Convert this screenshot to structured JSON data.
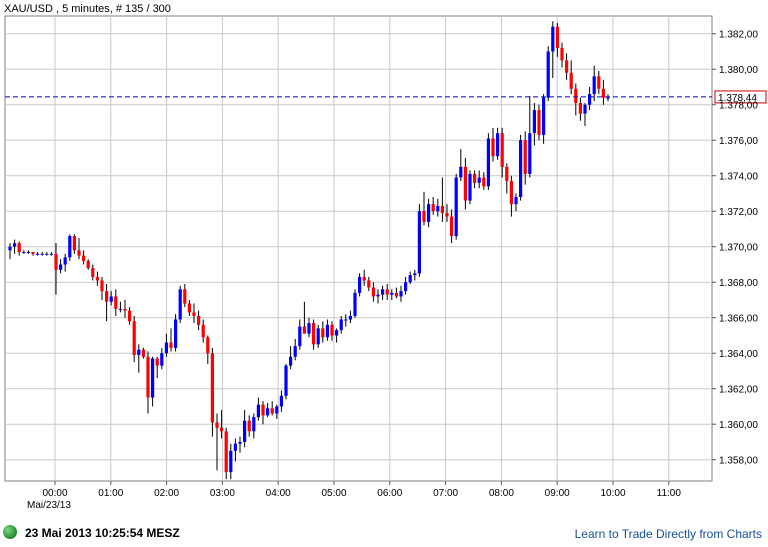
{
  "chart_data": {
    "type": "candlestick",
    "title": "XAU/USD , 5 minutes, # 135 / 300",
    "date_label": "Mai/23/13",
    "x_ticks": [
      "00:00",
      "01:00",
      "02:00",
      "03:00",
      "04:00",
      "05:00",
      "06:00",
      "07:00",
      "08:00",
      "09:00",
      "10:00",
      "11:00"
    ],
    "y_ticks": [
      "1.358,00",
      "1.360,00",
      "1.362,00",
      "1.364,00",
      "1.366,00",
      "1.368,00",
      "1.370,00",
      "1.372,00",
      "1.374,00",
      "1.376,00",
      "1.378,00",
      "1.380,00",
      "1.382,00"
    ],
    "ylim": [
      1356.8,
      1383.0
    ],
    "current_price": 1378.44,
    "current_price_label": "1.378,44",
    "grid": true,
    "colors": {
      "up": "#0000ff",
      "down": "#ff0000",
      "grid": "#c8c8c8",
      "current_line": "#0000cc"
    },
    "candles": [
      {
        "o": 1369.8,
        "h": 1370.2,
        "l": 1369.3,
        "c": 1370.0
      },
      {
        "o": 1370.0,
        "h": 1370.4,
        "l": 1369.6,
        "c": 1370.2
      },
      {
        "o": 1370.2,
        "h": 1370.3,
        "l": 1369.5,
        "c": 1369.7
      },
      {
        "o": 1369.7,
        "h": 1369.8,
        "l": 1369.6,
        "c": 1369.7
      },
      {
        "o": 1369.7,
        "h": 1369.8,
        "l": 1369.6,
        "c": 1369.7
      },
      {
        "o": 1369.7,
        "h": 1369.7,
        "l": 1369.5,
        "c": 1369.6
      },
      {
        "o": 1369.6,
        "h": 1369.7,
        "l": 1369.5,
        "c": 1369.6
      },
      {
        "o": 1369.6,
        "h": 1369.7,
        "l": 1369.5,
        "c": 1369.6
      },
      {
        "o": 1369.6,
        "h": 1369.7,
        "l": 1369.5,
        "c": 1369.6
      },
      {
        "o": 1369.6,
        "h": 1369.7,
        "l": 1369.5,
        "c": 1369.6
      },
      {
        "o": 1369.6,
        "h": 1370.2,
        "l": 1367.3,
        "c": 1368.7
      },
      {
        "o": 1368.7,
        "h": 1369.3,
        "l": 1368.5,
        "c": 1369.0
      },
      {
        "o": 1369.0,
        "h": 1369.6,
        "l": 1368.6,
        "c": 1369.4
      },
      {
        "o": 1369.4,
        "h": 1370.7,
        "l": 1369.2,
        "c": 1370.6
      },
      {
        "o": 1370.6,
        "h": 1370.7,
        "l": 1369.6,
        "c": 1369.8
      },
      {
        "o": 1369.8,
        "h": 1370.5,
        "l": 1369.3,
        "c": 1369.5
      },
      {
        "o": 1369.5,
        "h": 1369.8,
        "l": 1369.0,
        "c": 1369.2
      },
      {
        "o": 1369.2,
        "h": 1369.3,
        "l": 1368.7,
        "c": 1368.8
      },
      {
        "o": 1368.8,
        "h": 1369.0,
        "l": 1368.1,
        "c": 1368.3
      },
      {
        "o": 1368.3,
        "h": 1368.6,
        "l": 1367.8,
        "c": 1368.1
      },
      {
        "o": 1368.1,
        "h": 1368.3,
        "l": 1367.0,
        "c": 1367.5
      },
      {
        "o": 1367.5,
        "h": 1367.9,
        "l": 1365.8,
        "c": 1366.9
      },
      {
        "o": 1366.9,
        "h": 1367.5,
        "l": 1366.7,
        "c": 1367.2
      },
      {
        "o": 1367.2,
        "h": 1367.6,
        "l": 1366.1,
        "c": 1366.5
      },
      {
        "o": 1366.5,
        "h": 1366.9,
        "l": 1366.3,
        "c": 1366.5
      },
      {
        "o": 1366.5,
        "h": 1367.0,
        "l": 1366.0,
        "c": 1366.4
      },
      {
        "o": 1366.4,
        "h": 1366.6,
        "l": 1365.6,
        "c": 1365.8
      },
      {
        "o": 1365.8,
        "h": 1366.1,
        "l": 1363.5,
        "c": 1363.9
      },
      {
        "o": 1363.9,
        "h": 1364.5,
        "l": 1362.9,
        "c": 1364.2
      },
      {
        "o": 1364.2,
        "h": 1364.3,
        "l": 1363.7,
        "c": 1363.8
      },
      {
        "o": 1363.8,
        "h": 1364.1,
        "l": 1360.6,
        "c": 1361.5
      },
      {
        "o": 1361.5,
        "h": 1363.8,
        "l": 1361.0,
        "c": 1363.7
      },
      {
        "o": 1363.7,
        "h": 1363.8,
        "l": 1362.6,
        "c": 1363.3
      },
      {
        "o": 1363.3,
        "h": 1364.3,
        "l": 1363.1,
        "c": 1364.0
      },
      {
        "o": 1364.0,
        "h": 1365.1,
        "l": 1363.8,
        "c": 1364.6
      },
      {
        "o": 1364.6,
        "h": 1365.4,
        "l": 1364.1,
        "c": 1364.3
      },
      {
        "o": 1364.3,
        "h": 1366.2,
        "l": 1364.1,
        "c": 1365.9
      },
      {
        "o": 1365.9,
        "h": 1367.8,
        "l": 1365.7,
        "c": 1367.6
      },
      {
        "o": 1367.6,
        "h": 1367.9,
        "l": 1366.6,
        "c": 1366.8
      },
      {
        "o": 1366.8,
        "h": 1367.0,
        "l": 1366.1,
        "c": 1366.3
      },
      {
        "o": 1366.3,
        "h": 1366.8,
        "l": 1365.7,
        "c": 1366.1
      },
      {
        "o": 1366.1,
        "h": 1366.4,
        "l": 1365.3,
        "c": 1365.6
      },
      {
        "o": 1365.6,
        "h": 1365.9,
        "l": 1364.6,
        "c": 1364.9
      },
      {
        "o": 1364.9,
        "h": 1365.0,
        "l": 1363.4,
        "c": 1364.0
      },
      {
        "o": 1364.0,
        "h": 1364.3,
        "l": 1359.3,
        "c": 1360.1
      },
      {
        "o": 1360.1,
        "h": 1360.6,
        "l": 1357.4,
        "c": 1359.8
      },
      {
        "o": 1359.8,
        "h": 1360.8,
        "l": 1359.2,
        "c": 1359.6
      },
      {
        "o": 1359.6,
        "h": 1359.8,
        "l": 1356.9,
        "c": 1357.3
      },
      {
        "o": 1357.3,
        "h": 1358.9,
        "l": 1356.9,
        "c": 1358.5
      },
      {
        "o": 1358.5,
        "h": 1359.2,
        "l": 1357.9,
        "c": 1358.9
      },
      {
        "o": 1358.9,
        "h": 1359.3,
        "l": 1358.4,
        "c": 1359.0
      },
      {
        "o": 1359.0,
        "h": 1360.8,
        "l": 1358.7,
        "c": 1360.2
      },
      {
        "o": 1360.2,
        "h": 1360.5,
        "l": 1359.3,
        "c": 1359.6
      },
      {
        "o": 1359.6,
        "h": 1360.6,
        "l": 1359.2,
        "c": 1360.4
      },
      {
        "o": 1360.4,
        "h": 1361.5,
        "l": 1360.2,
        "c": 1361.1
      },
      {
        "o": 1361.1,
        "h": 1361.3,
        "l": 1360.0,
        "c": 1360.5
      },
      {
        "o": 1360.5,
        "h": 1361.2,
        "l": 1360.4,
        "c": 1360.9
      },
      {
        "o": 1360.9,
        "h": 1361.3,
        "l": 1360.5,
        "c": 1360.6
      },
      {
        "o": 1360.6,
        "h": 1361.1,
        "l": 1360.3,
        "c": 1361.0
      },
      {
        "o": 1361.0,
        "h": 1361.9,
        "l": 1360.7,
        "c": 1361.6
      },
      {
        "o": 1361.6,
        "h": 1363.4,
        "l": 1361.4,
        "c": 1363.3
      },
      {
        "o": 1363.3,
        "h": 1364.4,
        "l": 1363.1,
        "c": 1363.8
      },
      {
        "o": 1363.8,
        "h": 1364.8,
        "l": 1363.6,
        "c": 1364.4
      },
      {
        "o": 1364.4,
        "h": 1365.9,
        "l": 1364.2,
        "c": 1365.5
      },
      {
        "o": 1365.5,
        "h": 1366.9,
        "l": 1365.3,
        "c": 1365.1
      },
      {
        "o": 1365.1,
        "h": 1366.0,
        "l": 1364.9,
        "c": 1365.7
      },
      {
        "o": 1365.7,
        "h": 1365.9,
        "l": 1364.2,
        "c": 1364.5
      },
      {
        "o": 1364.5,
        "h": 1365.6,
        "l": 1364.3,
        "c": 1365.4
      },
      {
        "o": 1365.4,
        "h": 1365.8,
        "l": 1364.6,
        "c": 1364.9
      },
      {
        "o": 1364.9,
        "h": 1365.9,
        "l": 1364.7,
        "c": 1365.6
      },
      {
        "o": 1365.6,
        "h": 1365.8,
        "l": 1364.7,
        "c": 1365.0
      },
      {
        "o": 1365.0,
        "h": 1365.4,
        "l": 1364.6,
        "c": 1365.3
      },
      {
        "o": 1365.3,
        "h": 1366.1,
        "l": 1365.1,
        "c": 1365.9
      },
      {
        "o": 1365.9,
        "h": 1366.2,
        "l": 1365.5,
        "c": 1365.9
      },
      {
        "o": 1365.9,
        "h": 1366.4,
        "l": 1365.7,
        "c": 1366.1
      },
      {
        "o": 1366.1,
        "h": 1367.6,
        "l": 1366.0,
        "c": 1367.4
      },
      {
        "o": 1367.4,
        "h": 1368.5,
        "l": 1367.2,
        "c": 1368.3
      },
      {
        "o": 1368.3,
        "h": 1368.7,
        "l": 1367.8,
        "c": 1368.1
      },
      {
        "o": 1368.1,
        "h": 1368.3,
        "l": 1367.5,
        "c": 1367.7
      },
      {
        "o": 1367.7,
        "h": 1368.0,
        "l": 1366.9,
        "c": 1367.2
      },
      {
        "o": 1367.2,
        "h": 1367.6,
        "l": 1366.8,
        "c": 1367.3
      },
      {
        "o": 1367.3,
        "h": 1367.8,
        "l": 1367.0,
        "c": 1367.6
      },
      {
        "o": 1367.6,
        "h": 1367.9,
        "l": 1367.0,
        "c": 1367.3
      },
      {
        "o": 1367.3,
        "h": 1367.6,
        "l": 1367.0,
        "c": 1367.4
      },
      {
        "o": 1367.4,
        "h": 1367.7,
        "l": 1367.1,
        "c": 1367.2
      },
      {
        "o": 1367.2,
        "h": 1367.8,
        "l": 1366.9,
        "c": 1367.5
      },
      {
        "o": 1367.5,
        "h": 1368.3,
        "l": 1367.3,
        "c": 1368.0
      },
      {
        "o": 1368.0,
        "h": 1368.6,
        "l": 1367.9,
        "c": 1368.4
      },
      {
        "o": 1368.4,
        "h": 1368.7,
        "l": 1368.1,
        "c": 1368.5
      },
      {
        "o": 1368.5,
        "h": 1372.4,
        "l": 1368.3,
        "c": 1372.0
      },
      {
        "o": 1372.0,
        "h": 1373.1,
        "l": 1371.2,
        "c": 1371.4
      },
      {
        "o": 1371.4,
        "h": 1372.7,
        "l": 1371.1,
        "c": 1372.4
      },
      {
        "o": 1372.4,
        "h": 1372.8,
        "l": 1371.8,
        "c": 1372.0
      },
      {
        "o": 1372.0,
        "h": 1372.7,
        "l": 1371.7,
        "c": 1372.3
      },
      {
        "o": 1372.3,
        "h": 1373.9,
        "l": 1371.4,
        "c": 1371.9
      },
      {
        "o": 1371.9,
        "h": 1372.4,
        "l": 1371.4,
        "c": 1371.7
      },
      {
        "o": 1371.7,
        "h": 1372.1,
        "l": 1370.2,
        "c": 1370.6
      },
      {
        "o": 1370.6,
        "h": 1374.1,
        "l": 1370.4,
        "c": 1373.9
      },
      {
        "o": 1373.9,
        "h": 1375.5,
        "l": 1373.7,
        "c": 1374.5
      },
      {
        "o": 1374.5,
        "h": 1375.0,
        "l": 1372.1,
        "c": 1372.6
      },
      {
        "o": 1372.6,
        "h": 1374.3,
        "l": 1372.4,
        "c": 1374.1
      },
      {
        "o": 1374.1,
        "h": 1374.3,
        "l": 1373.3,
        "c": 1373.6
      },
      {
        "o": 1373.6,
        "h": 1374.3,
        "l": 1373.3,
        "c": 1373.9
      },
      {
        "o": 1373.9,
        "h": 1374.2,
        "l": 1373.2,
        "c": 1373.4
      },
      {
        "o": 1373.4,
        "h": 1376.4,
        "l": 1373.2,
        "c": 1376.1
      },
      {
        "o": 1376.1,
        "h": 1376.7,
        "l": 1374.8,
        "c": 1375.1
      },
      {
        "o": 1375.1,
        "h": 1376.7,
        "l": 1374.9,
        "c": 1376.4
      },
      {
        "o": 1376.4,
        "h": 1376.7,
        "l": 1373.9,
        "c": 1374.5
      },
      {
        "o": 1374.5,
        "h": 1374.7,
        "l": 1373.0,
        "c": 1373.7
      },
      {
        "o": 1373.7,
        "h": 1374.0,
        "l": 1371.7,
        "c": 1372.4
      },
      {
        "o": 1372.4,
        "h": 1373.0,
        "l": 1372.0,
        "c": 1372.8
      },
      {
        "o": 1372.8,
        "h": 1376.3,
        "l": 1372.6,
        "c": 1376.0
      },
      {
        "o": 1376.0,
        "h": 1376.5,
        "l": 1373.5,
        "c": 1374.1
      },
      {
        "o": 1374.1,
        "h": 1378.5,
        "l": 1373.9,
        "c": 1376.4
      },
      {
        "o": 1376.4,
        "h": 1378.1,
        "l": 1375.7,
        "c": 1377.7
      },
      {
        "o": 1377.7,
        "h": 1378.0,
        "l": 1376.0,
        "c": 1376.3
      },
      {
        "o": 1376.3,
        "h": 1378.6,
        "l": 1375.8,
        "c": 1378.4
      },
      {
        "o": 1378.4,
        "h": 1381.3,
        "l": 1378.2,
        "c": 1381.0
      },
      {
        "o": 1381.0,
        "h": 1382.7,
        "l": 1379.5,
        "c": 1382.4
      },
      {
        "o": 1382.4,
        "h": 1382.6,
        "l": 1380.7,
        "c": 1381.2
      },
      {
        "o": 1381.2,
        "h": 1381.5,
        "l": 1380.1,
        "c": 1380.5
      },
      {
        "o": 1380.5,
        "h": 1380.9,
        "l": 1379.4,
        "c": 1379.8
      },
      {
        "o": 1379.8,
        "h": 1380.5,
        "l": 1378.6,
        "c": 1378.9
      },
      {
        "o": 1378.9,
        "h": 1379.2,
        "l": 1377.4,
        "c": 1378.1
      },
      {
        "o": 1378.1,
        "h": 1378.4,
        "l": 1377.1,
        "c": 1377.5
      },
      {
        "o": 1377.5,
        "h": 1378.1,
        "l": 1376.8,
        "c": 1378.0
      },
      {
        "o": 1378.0,
        "h": 1379.0,
        "l": 1377.7,
        "c": 1378.6
      },
      {
        "o": 1378.6,
        "h": 1380.2,
        "l": 1378.2,
        "c": 1379.6
      },
      {
        "o": 1379.6,
        "h": 1379.9,
        "l": 1378.6,
        "c": 1378.9
      },
      {
        "o": 1378.9,
        "h": 1379.4,
        "l": 1378.0,
        "c": 1378.4
      },
      {
        "o": 1378.4,
        "h": 1378.6,
        "l": 1378.2,
        "c": 1378.4
      }
    ]
  },
  "footer": {
    "timestamp": "23 Mai 2013 10:25:54 MESZ",
    "learn_link": "Learn to Trade Directly from Charts"
  }
}
